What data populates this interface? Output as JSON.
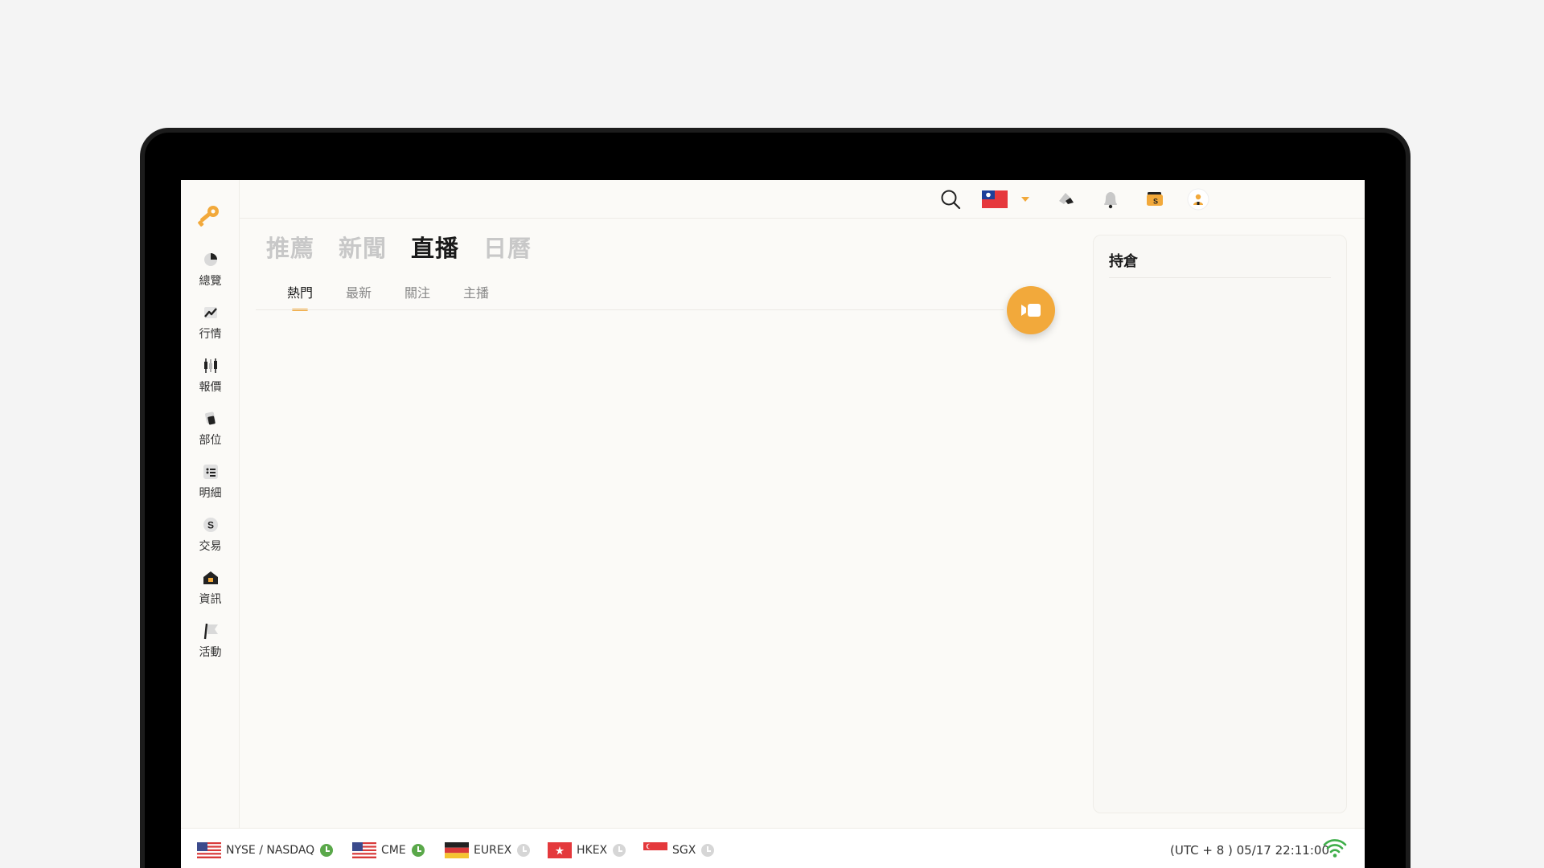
{
  "sidebar": {
    "items": [
      {
        "label": "總覽",
        "icon": "pie-chart-icon"
      },
      {
        "label": "行情",
        "icon": "trend-icon"
      },
      {
        "label": "報價",
        "icon": "candlestick-icon"
      },
      {
        "label": "部位",
        "icon": "position-icon"
      },
      {
        "label": "明細",
        "icon": "list-icon"
      },
      {
        "label": "交易",
        "icon": "dollar-coin-icon"
      },
      {
        "label": "資訊",
        "icon": "house-icon"
      },
      {
        "label": "活動",
        "icon": "flag-icon"
      }
    ]
  },
  "topbar": {
    "icons": [
      "search-icon",
      "taiwan-flag-icon",
      "chevron-down-icon",
      "pen-icon",
      "bell-icon",
      "wallet-icon",
      "user-icon"
    ]
  },
  "main": {
    "tabs": [
      {
        "label": "推薦",
        "active": false
      },
      {
        "label": "新聞",
        "active": false
      },
      {
        "label": "直播",
        "active": true
      },
      {
        "label": "日曆",
        "active": false
      }
    ],
    "sub_tabs": [
      {
        "label": "熱門",
        "active": true
      },
      {
        "label": "最新",
        "active": false
      },
      {
        "label": "關注",
        "active": false
      },
      {
        "label": "主播",
        "active": false
      }
    ],
    "live_button_icon": "video-camera-icon"
  },
  "panel": {
    "title": "持倉"
  },
  "bottombar": {
    "markets": [
      {
        "label": "NYSE / NASDAQ",
        "flag": "us-flag-icon",
        "status": "open"
      },
      {
        "label": "CME",
        "flag": "us-flag-icon",
        "status": "open"
      },
      {
        "label": "EUREX",
        "flag": "germany-flag-icon",
        "status": "closed"
      },
      {
        "label": "HKEX",
        "flag": "hong-kong-flag-icon",
        "status": "closed"
      },
      {
        "label": "SGX",
        "flag": "singapore-flag-icon",
        "status": "closed"
      }
    ],
    "time": "(UTC + 8 ) 05/17 22:11:00",
    "wifi_icon": "wifi-icon"
  },
  "colors": {
    "accent": "#f2a93b",
    "open_status": "#5aa84a",
    "closed_status": "#d6d6d6"
  }
}
